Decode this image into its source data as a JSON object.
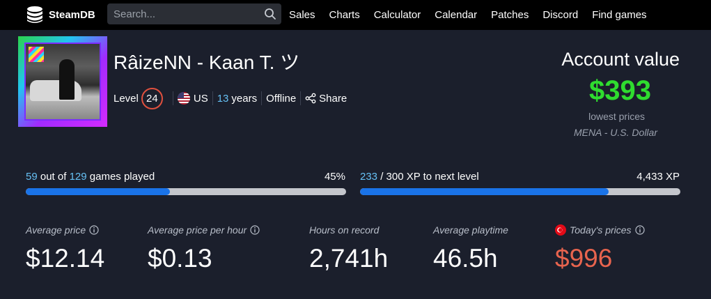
{
  "nav": {
    "logo_text": "SteamDB",
    "search_placeholder": "Search...",
    "menu": [
      "Sales",
      "Charts",
      "Calculator",
      "Calendar",
      "Patches",
      "Discord",
      "Find games"
    ]
  },
  "profile": {
    "name": "RâizeNN - Kaan T. ツ",
    "level_label": "Level",
    "level": "24",
    "country": "US",
    "years_num": "13",
    "years_label": "years",
    "status": "Offline",
    "share_label": "Share"
  },
  "account": {
    "title": "Account value",
    "value": "$393",
    "subtitle": "lowest prices",
    "region": "MENA - U.S. Dollar"
  },
  "games_progress": {
    "played": "59",
    "text_mid": "out of",
    "total": "129",
    "text_end": "games played",
    "percent_label": "45%",
    "fraction": 0.45
  },
  "xp_progress": {
    "current": "233",
    "text": "/ 300 XP to next level",
    "total_xp": "4,433 XP",
    "fraction": 0.776
  },
  "stats": [
    {
      "label": "Average price",
      "value": "$12.14"
    },
    {
      "label": "Average price per hour",
      "value": "$0.13"
    },
    {
      "label": "Hours on record",
      "value": "2,741h"
    },
    {
      "label": "Average playtime",
      "value": "46.5h"
    },
    {
      "label": "Today's prices",
      "value": "$996"
    }
  ],
  "colors": {
    "background": "#1b1f2c",
    "accent_blue": "#66c0f4",
    "value_green": "#2fdc2f",
    "price_red": "#e8644e",
    "progress_blue": "#1a73e8"
  }
}
